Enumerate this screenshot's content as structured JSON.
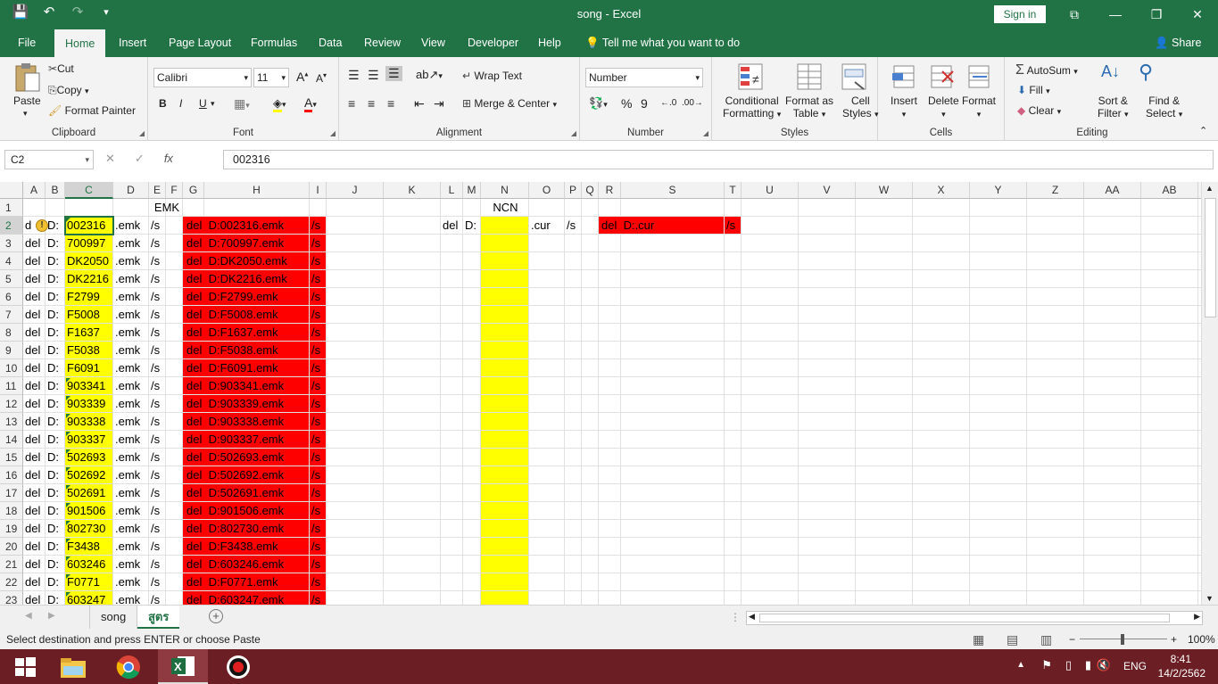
{
  "window": {
    "title": "song  -  Excel",
    "sign_in": "Sign in",
    "qat_save": "💾",
    "qat_undo": "↶",
    "qat_redo": "↷",
    "qat_more": "▾",
    "restore": "⧉",
    "minimize": "—",
    "maximize": "❐",
    "close": "✕"
  },
  "tabs": [
    "File",
    "Home",
    "Insert",
    "Page Layout",
    "Formulas",
    "Data",
    "Review",
    "View",
    "Developer",
    "Help"
  ],
  "tell_me": "Tell me what you want to do",
  "share": "Share",
  "ribbon": {
    "clipboard": {
      "label": "Clipboard",
      "paste": "Paste",
      "cut": "Cut",
      "copy": "Copy",
      "format_painter": "Format Painter"
    },
    "font": {
      "label": "Font",
      "name": "Calibri",
      "size": "11",
      "bold": "B",
      "italic": "I",
      "underline": "U"
    },
    "alignment": {
      "label": "Alignment",
      "wrap": "Wrap Text",
      "merge": "Merge & Center"
    },
    "number": {
      "label": "Number",
      "format": "Number",
      "percent": "%",
      "comma": "9"
    },
    "styles": {
      "label": "Styles",
      "conditional_1": "Conditional",
      "conditional_2": "Formatting",
      "format_as_1": "Format as",
      "format_as_2": "Table",
      "cell_1": "Cell",
      "cell_2": "Styles"
    },
    "cells": {
      "label": "Cells",
      "insert": "Insert",
      "delete": "Delete",
      "format": "Format"
    },
    "editing": {
      "label": "Editing",
      "autosum": "AutoSum",
      "fill": "Fill",
      "clear": "Clear",
      "sort_1": "Sort &",
      "sort_2": "Filter",
      "find_1": "Find &",
      "find_2": "Select"
    }
  },
  "formula_bar": {
    "name_box": "C2",
    "fx": "fx",
    "cancel": "✕",
    "enter": "✓",
    "value": "002316"
  },
  "columns": [
    "A",
    "B",
    "C",
    "D",
    "E",
    "F",
    "G",
    "H",
    "I",
    "J",
    "K",
    "L",
    "M",
    "N",
    "O",
    "P",
    "Q",
    "R",
    "S",
    "T",
    "U",
    "V",
    "W",
    "X",
    "Y",
    "Z",
    "AA",
    "AB",
    "AC"
  ],
  "rows": [
    "1",
    "2",
    "3",
    "4",
    "5",
    "6",
    "7",
    "8",
    "9",
    "10",
    "11",
    "12",
    "13",
    "14",
    "15",
    "16",
    "17",
    "18",
    "19",
    "20",
    "21",
    "22",
    "23"
  ],
  "header_emk": "EMK",
  "header_ncn": "NCN",
  "codes": [
    "002316",
    "700997",
    "DK2050",
    "DK2216",
    "F2799",
    "F5008",
    "F1637",
    "F5038",
    "F6091",
    "903341",
    "903339",
    "903338",
    "903337",
    "502693",
    "502692",
    "502691",
    "901506",
    "802730",
    "F3438",
    "603246",
    "F0771",
    "603247"
  ],
  "cell_del": "del",
  "cell_drive": "D:",
  "cell_del_first": "d",
  "cell_ext": ".emk",
  "cell_switch": "/s",
  "formula_prefix": "del  D:",
  "ncn": {
    "del": "del",
    "drive": "D:",
    "ext": ".cur",
    "switch": "/s",
    "formula": "del  D:.cur"
  },
  "sheets": [
    "song",
    "สูตร"
  ],
  "add_sheet": "+",
  "status_text": "Select destination and press ENTER or choose Paste",
  "zoom": "100%",
  "taskbar": {
    "lang": "ENG",
    "time": "8:41",
    "date": "14/2/2562"
  },
  "colors": {
    "excel_green": "#217346",
    "highlight_yellow": "#ffff00",
    "highlight_red": "#ff0000",
    "taskbar": "#6b1f24"
  }
}
